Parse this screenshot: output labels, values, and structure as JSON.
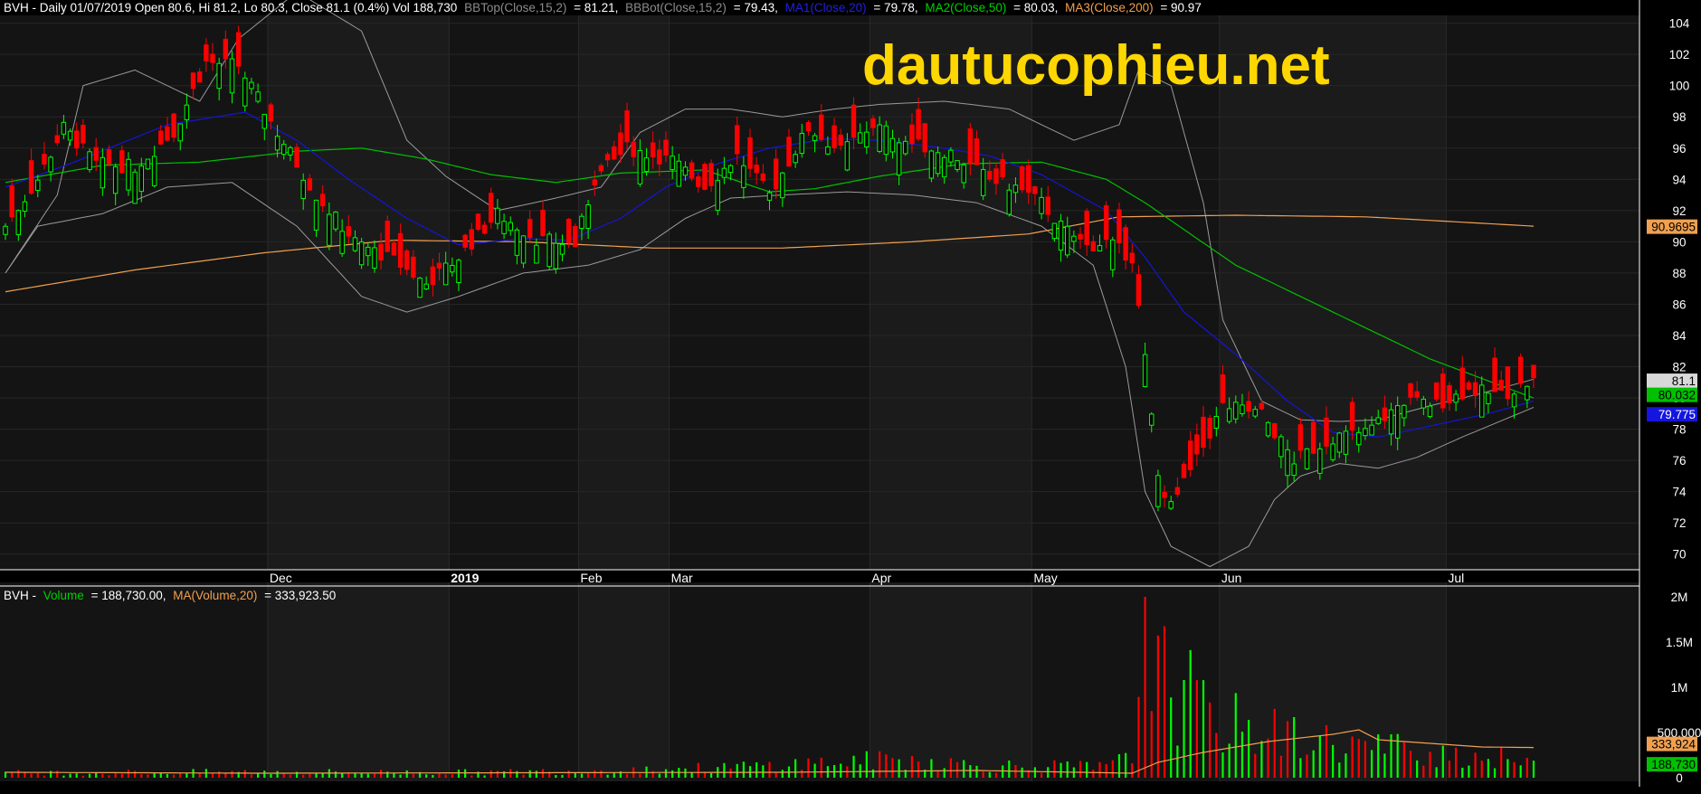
{
  "header": {
    "price": {
      "prefix": "BVH - Daily 01/07/2019 Open 80.6, Hi 81.2, Lo 80.3, Close 81.1 (0.4%) Vol 188,730",
      "bbtop_label": "BBTop(Close,15,2)",
      "bbtop_value": "= 81.21,",
      "bbbot_label": "BBBot(Close,15,2)",
      "bbbot_value": "= 79.43,",
      "ma1_label": "MA1(Close,20)",
      "ma1_value": "= 79.78,",
      "ma2_label": "MA2(Close,50)",
      "ma2_value": "= 80.03,",
      "ma3_label": "MA3(Close,200)",
      "ma3_value": "= 90.97"
    },
    "volume": {
      "prefix": "BVH -",
      "vol_label": "Volume",
      "vol_value": "= 188,730.00,",
      "ma_label": "MA(Volume,20)",
      "ma_value": "= 333,923.50"
    }
  },
  "watermark": "dautucophieu.net",
  "colors": {
    "background": "#000000",
    "up": "#00ff00",
    "down": "#ff0000",
    "ma1": "#1515d8",
    "ma2": "#00c000",
    "ma3": "#f0a050",
    "bollinger": "#9a9a9a",
    "watermark": "#ffd700"
  },
  "chart_data": [
    {
      "type": "candlestick",
      "ylim": [
        69,
        104.5
      ],
      "y_ticks": [
        70,
        72,
        74,
        76,
        78,
        80,
        82,
        84,
        86,
        88,
        90,
        92,
        94,
        96,
        98,
        100,
        102,
        104
      ],
      "x_labels": [
        "Dec",
        "2019",
        "Feb",
        "Mar",
        "Apr",
        "May",
        "Jun",
        "Jul"
      ],
      "value_badges": [
        {
          "label": "MA3",
          "value": "90.9695"
        },
        {
          "label": "Close",
          "value": "81.1"
        },
        {
          "label": "MA2",
          "value": "80.032"
        },
        {
          "label": "MA1",
          "value": "79.775"
        }
      ],
      "close_anchors": [
        [
          0,
          91.0
        ],
        [
          5,
          94.0
        ],
        [
          9,
          97.3
        ],
        [
          14,
          95.0
        ],
        [
          20,
          94.8
        ],
        [
          26,
          97.0
        ],
        [
          31,
          101.5
        ],
        [
          36,
          101.3
        ],
        [
          42,
          97.0
        ],
        [
          48,
          93.0
        ],
        [
          54,
          90.0
        ],
        [
          60,
          88.8
        ],
        [
          65,
          87.3
        ],
        [
          70,
          89.0
        ],
        [
          76,
          91.8
        ],
        [
          82,
          90.2
        ],
        [
          88,
          89.8
        ],
        [
          91,
          94.0
        ],
        [
          96,
          96.0
        ],
        [
          103,
          95.2
        ],
        [
          108,
          93.5
        ],
        [
          113,
          95.5
        ],
        [
          118,
          93.0
        ],
        [
          124,
          97.3
        ],
        [
          129,
          95.8
        ],
        [
          134,
          97.5
        ],
        [
          140,
          96.3
        ],
        [
          146,
          95.7
        ],
        [
          152,
          94.0
        ],
        [
          156,
          93.5
        ],
        [
          160,
          92.5
        ],
        [
          163,
          91.0
        ],
        [
          167,
          89.7
        ],
        [
          170,
          90.0
        ],
        [
          174,
          89.0
        ],
        [
          176,
          82.5
        ],
        [
          178,
          75.0
        ],
        [
          180,
          73.0
        ],
        [
          182,
          74.5
        ],
        [
          184,
          76.0
        ],
        [
          188,
          79.5
        ],
        [
          194,
          79.0
        ],
        [
          199,
          76.0
        ],
        [
          205,
          77.5
        ],
        [
          210,
          77.8
        ],
        [
          216,
          79.8
        ],
        [
          221,
          79.6
        ],
        [
          226,
          80.5
        ],
        [
          231,
          80.2
        ],
        [
          236,
          81.1
        ]
      ],
      "ma1_anchors": [
        [
          0,
          93.5
        ],
        [
          10,
          95.0
        ],
        [
          25,
          97.5
        ],
        [
          37,
          98.3
        ],
        [
          45,
          96.5
        ],
        [
          53,
          94.0
        ],
        [
          62,
          91.5
        ],
        [
          70,
          89.8
        ],
        [
          80,
          90.2
        ],
        [
          87,
          90.1
        ],
        [
          95,
          91.5
        ],
        [
          102,
          93.5
        ],
        [
          110,
          95.0
        ],
        [
          118,
          96.0
        ],
        [
          127,
          96.6
        ],
        [
          135,
          96.5
        ],
        [
          145,
          96.0
        ],
        [
          152,
          95.5
        ],
        [
          160,
          94.3
        ],
        [
          170,
          92.0
        ],
        [
          176,
          89.0
        ],
        [
          182,
          85.5
        ],
        [
          190,
          82.8
        ],
        [
          198,
          79.8
        ],
        [
          205,
          77.8
        ],
        [
          212,
          77.5
        ],
        [
          220,
          78.2
        ],
        [
          229,
          79.0
        ],
        [
          236,
          79.8
        ]
      ],
      "ma2_anchors": [
        [
          0,
          93.8
        ],
        [
          15,
          94.9
        ],
        [
          30,
          95.1
        ],
        [
          45,
          95.8
        ],
        [
          55,
          96.0
        ],
        [
          65,
          95.3
        ],
        [
          75,
          94.3
        ],
        [
          85,
          93.8
        ],
        [
          95,
          94.4
        ],
        [
          108,
          94.6
        ],
        [
          118,
          93.2
        ],
        [
          125,
          93.4
        ],
        [
          135,
          94.2
        ],
        [
          148,
          95.0
        ],
        [
          160,
          95.1
        ],
        [
          170,
          94.0
        ],
        [
          176,
          92.5
        ],
        [
          190,
          88.5
        ],
        [
          205,
          85.5
        ],
        [
          220,
          82.5
        ],
        [
          236,
          80.0
        ]
      ],
      "ma3_anchors": [
        [
          0,
          86.8
        ],
        [
          20,
          88.2
        ],
        [
          40,
          89.3
        ],
        [
          60,
          90.1
        ],
        [
          80,
          90.0
        ],
        [
          100,
          89.6
        ],
        [
          120,
          89.6
        ],
        [
          140,
          90.0
        ],
        [
          158,
          90.5
        ],
        [
          172,
          91.6
        ],
        [
          190,
          91.7
        ],
        [
          210,
          91.6
        ],
        [
          236,
          91.0
        ]
      ],
      "bbupper_anchors": [
        [
          0,
          88.0
        ],
        [
          8,
          93.0
        ],
        [
          12,
          100.0
        ],
        [
          20,
          101.0
        ],
        [
          30,
          99.0
        ],
        [
          36,
          103.0
        ],
        [
          45,
          106.0
        ],
        [
          55,
          103.5
        ],
        [
          62,
          96.5
        ],
        [
          68,
          94.2
        ],
        [
          76,
          92.0
        ],
        [
          85,
          92.8
        ],
        [
          92,
          93.5
        ],
        [
          98,
          97.0
        ],
        [
          105,
          98.5
        ],
        [
          112,
          98.5
        ],
        [
          120,
          98.0
        ],
        [
          128,
          98.5
        ],
        [
          135,
          98.8
        ],
        [
          145,
          99.0
        ],
        [
          155,
          98.5
        ],
        [
          165,
          96.5
        ],
        [
          172,
          97.5
        ],
        [
          175,
          101.0
        ],
        [
          180,
          100.0
        ],
        [
          185,
          92.5
        ],
        [
          188,
          85.0
        ],
        [
          194,
          79.8
        ],
        [
          200,
          78.6
        ],
        [
          206,
          78.5
        ],
        [
          212,
          78.6
        ],
        [
          220,
          79.5
        ],
        [
          228,
          80.3
        ],
        [
          236,
          81.2
        ]
      ],
      "bblower_anchors": [
        [
          0,
          88.0
        ],
        [
          5,
          91.0
        ],
        [
          15,
          91.8
        ],
        [
          25,
          93.5
        ],
        [
          35,
          93.8
        ],
        [
          45,
          91.0
        ],
        [
          55,
          86.5
        ],
        [
          62,
          85.5
        ],
        [
          70,
          86.5
        ],
        [
          80,
          88.0
        ],
        [
          90,
          88.5
        ],
        [
          98,
          89.5
        ],
        [
          105,
          91.5
        ],
        [
          112,
          92.8
        ],
        [
          120,
          93.0
        ],
        [
          130,
          93.2
        ],
        [
          140,
          93.0
        ],
        [
          150,
          92.5
        ],
        [
          160,
          91.0
        ],
        [
          168,
          88.5
        ],
        [
          173,
          82.0
        ],
        [
          176,
          74.0
        ],
        [
          180,
          70.5
        ],
        [
          186,
          69.2
        ],
        [
          192,
          70.5
        ],
        [
          196,
          73.5
        ],
        [
          200,
          75.0
        ],
        [
          206,
          75.8
        ],
        [
          212,
          75.5
        ],
        [
          218,
          76.2
        ],
        [
          225,
          77.5
        ],
        [
          236,
          79.4
        ]
      ],
      "series": [
        {
          "name": "BBTop(Close,15,2)",
          "last": 81.21
        },
        {
          "name": "BBBot(Close,15,2)",
          "last": 79.43
        },
        {
          "name": "MA1(Close,20)",
          "last": 79.78
        },
        {
          "name": "MA2(Close,50)",
          "last": 80.03
        },
        {
          "name": "MA3(Close,200)",
          "last": 90.97
        }
      ]
    },
    {
      "type": "bar",
      "ylim": [
        0,
        2100000
      ],
      "y_ticks": [
        {
          "value": 0,
          "label": "0"
        },
        {
          "value": 500000,
          "label": "500,000"
        },
        {
          "value": 1000000,
          "label": "1M"
        },
        {
          "value": 1500000,
          "label": "1.5M"
        },
        {
          "value": 2000000,
          "label": "2M"
        }
      ],
      "value_badges": [
        {
          "label": "MA(Volume,20)",
          "value": "333,924"
        },
        {
          "label": "Volume",
          "value": "188,730"
        }
      ],
      "volume_anchors": [
        [
          0,
          60000
        ],
        [
          40,
          70000
        ],
        [
          75,
          65000
        ],
        [
          110,
          120000
        ],
        [
          130,
          200000
        ],
        [
          140,
          220000
        ],
        [
          150,
          150000
        ],
        [
          170,
          130000
        ],
        [
          174,
          250000
        ],
        [
          176,
          2000000
        ],
        [
          180,
          950000
        ],
        [
          182,
          1080000
        ],
        [
          186,
          700000
        ],
        [
          190,
          650000
        ],
        [
          196,
          550000
        ],
        [
          202,
          450000
        ],
        [
          210,
          380000
        ],
        [
          220,
          330000
        ],
        [
          236,
          188730
        ]
      ],
      "ma_volume_anchors": [
        [
          0,
          60000
        ],
        [
          40,
          50000
        ],
        [
          80,
          55000
        ],
        [
          120,
          60000
        ],
        [
          150,
          80000
        ],
        [
          174,
          50000
        ],
        [
          178,
          170000
        ],
        [
          185,
          280000
        ],
        [
          195,
          400000
        ],
        [
          205,
          480000
        ],
        [
          209,
          530000
        ],
        [
          212,
          420000
        ],
        [
          220,
          380000
        ],
        [
          228,
          340000
        ],
        [
          236,
          333924
        ]
      ]
    }
  ]
}
